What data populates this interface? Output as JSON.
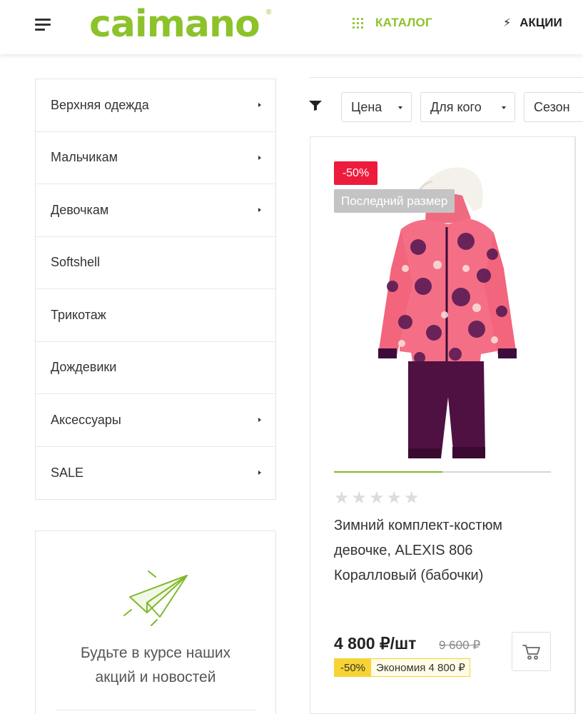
{
  "header": {
    "logo_text": "caimano",
    "logo_mark": "®",
    "catalog_label": "КАТАЛОГ",
    "sales_label": "АКЦИИ",
    "brand_color": "#8cc22a",
    "icons": [
      "menu-icon",
      "grid-icon",
      "bolt-icon"
    ]
  },
  "sidebar": {
    "items": [
      {
        "label": "Верхняя одежда",
        "has_submenu": true
      },
      {
        "label": "Мальчикам",
        "has_submenu": true
      },
      {
        "label": "Девочкам",
        "has_submenu": true
      },
      {
        "label": "Softshell",
        "has_submenu": false
      },
      {
        "label": "Трикотаж",
        "has_submenu": false
      },
      {
        "label": "Дождевики",
        "has_submenu": false
      },
      {
        "label": "Аксессуары",
        "has_submenu": true
      },
      {
        "label": "SALE",
        "has_submenu": true
      }
    ]
  },
  "subscribe": {
    "text_line1": "Будьте в курсе наших",
    "text_line2": "акций и новостей",
    "icon": "paper-plane-icon"
  },
  "filters": {
    "icon": "filter-icon",
    "price_label": "Цена",
    "for_whom_label": "Для кого",
    "season_label": "Сезон"
  },
  "product": {
    "discount_badge": "-50%",
    "last_size_badge": "Последний размер",
    "rating": 0,
    "rating_max": 5,
    "title": "Зимний комплект-костюм девочке, ALEXIS 806 Коралловый (бабочки)",
    "price": "4 800 ₽/шт",
    "old_price": "9 600 ₽",
    "save_percent": "-50%",
    "save_text": "Экономия 4 800 ₽",
    "gallery_progress": 0.5,
    "colors": {
      "sale_badge": "#ee1c3c",
      "save_highlight": "#f7d334"
    }
  }
}
